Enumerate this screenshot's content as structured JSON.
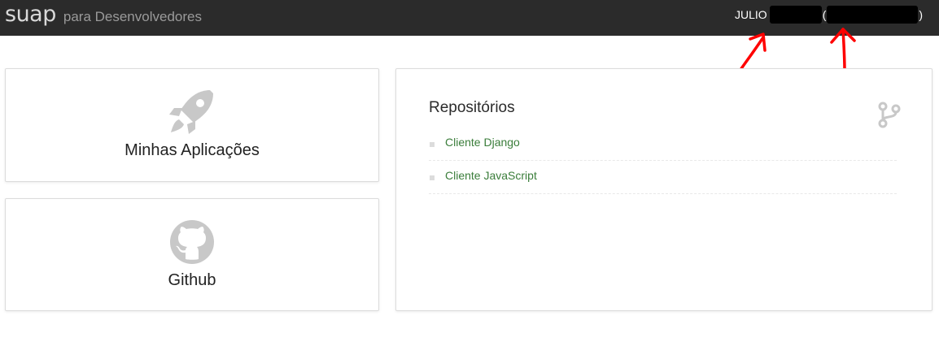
{
  "header": {
    "brand_logo": "suap",
    "brand_subtitle": "para Desenvolvedores",
    "user_first_name": "JULIO",
    "open_paren": "(",
    "close_paren": ")"
  },
  "cards": {
    "apps": {
      "label": "Minhas Aplicações",
      "icon": "rocket-icon"
    },
    "github": {
      "label": "Github",
      "icon": "github-icon"
    }
  },
  "repositories": {
    "title": "Repositórios",
    "icon": "branch-icon",
    "items": [
      {
        "label": "Cliente Django"
      },
      {
        "label": "Cliente JavaScript"
      }
    ]
  },
  "colors": {
    "topbar": "#2b2b2b",
    "link": "#3a7d3a",
    "icon_gray": "#c8c8c8",
    "annotation_red": "#ff0000"
  }
}
